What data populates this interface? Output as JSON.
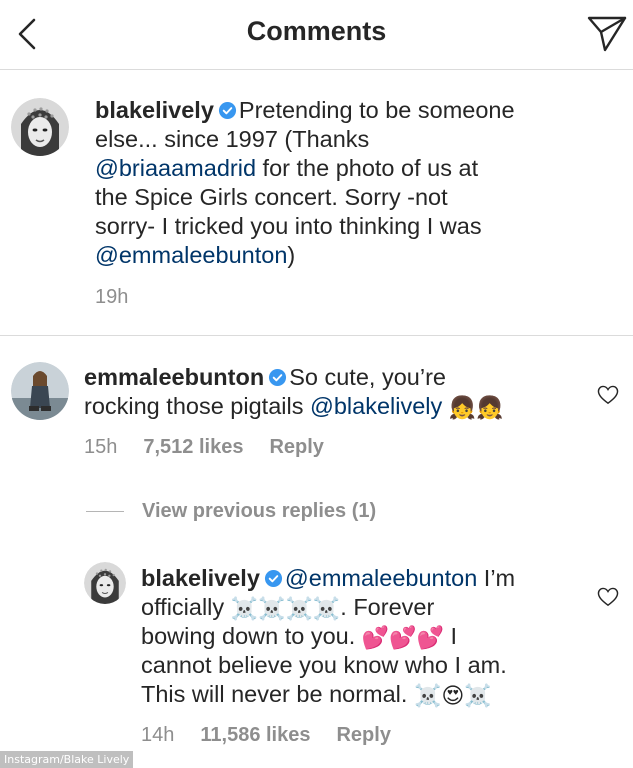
{
  "header": {
    "title": "Comments"
  },
  "caption": {
    "username": "blakelively",
    "text_1": "Pretending to be someone",
    "text_2": "else... since 1997 (Thanks",
    "mention_1": "@briaaamadrid",
    "text_3": " for the photo of us at",
    "text_4": "the Spice Girls concert. Sorry -not",
    "text_5": "sorry- I tricked you into thinking I was",
    "mention_2": "@emmaleebunton",
    "text_6": ")",
    "time": "19h"
  },
  "comment": {
    "username": "emmaleebunton",
    "text_1": "So cute, you’re",
    "text_2": "rocking those pigtails ",
    "mention": "@blakelively",
    "emoji": "👧👧",
    "time": "15h",
    "likes": "7,512 likes",
    "reply": "Reply"
  },
  "view_previous": "View previous replies (1)",
  "reply": {
    "username": "blakelively",
    "mention": "@emmaleebunton",
    "text_1": " I’m",
    "text_2a": "officially ",
    "emoji_1": "☠️☠️☠️☠️",
    "text_2b": ". Forever",
    "text_3": "bowing down to you. ",
    "emoji_2": "💕💕💕",
    "text_3b": " I",
    "text_4": "cannot believe you know who I am.",
    "text_5": "This will never be normal. ",
    "emoji_3": "☠️😍☠️",
    "time": "14h",
    "likes": "11,586 likes",
    "reply": "Reply"
  },
  "credit": "Instagram/Blake Lively",
  "colors": {
    "mention": "#003569",
    "verified": "#3897f0",
    "meta": "#8e8e8e",
    "divider": "#dbdbdb"
  }
}
